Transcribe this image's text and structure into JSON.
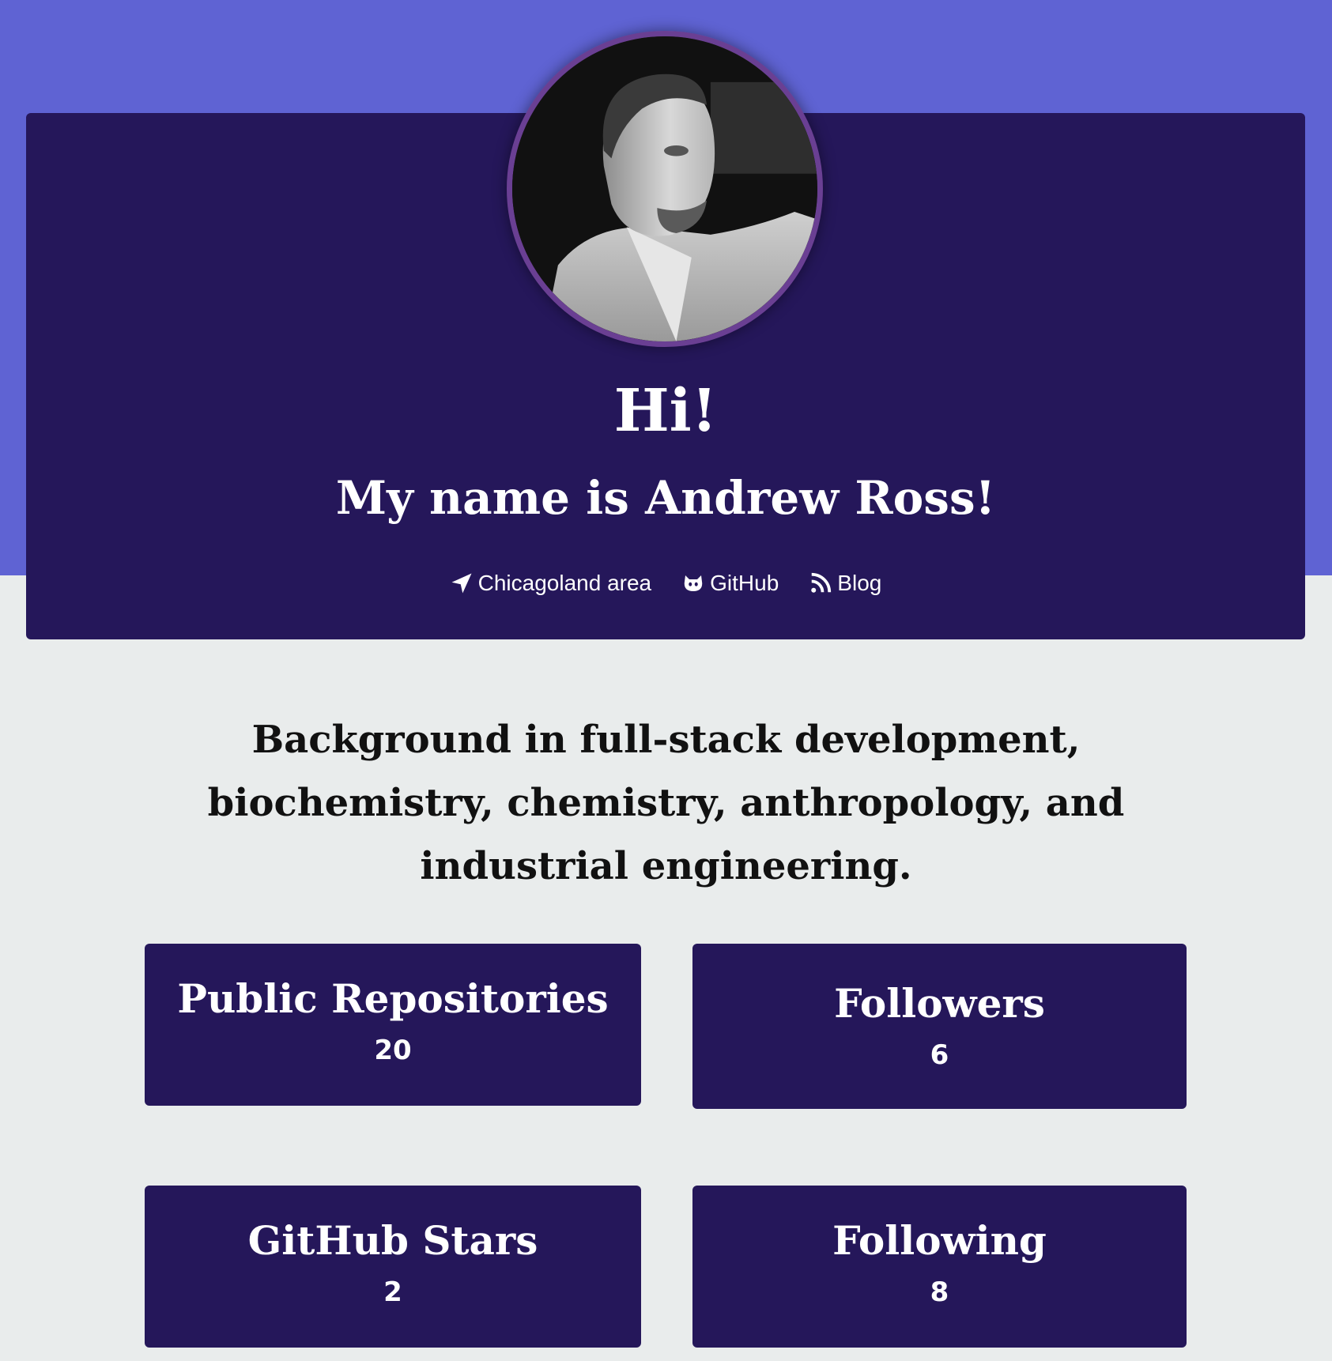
{
  "hero": {
    "greeting": "Hi!",
    "name_line": "My name is Andrew Ross!"
  },
  "links": [
    {
      "icon": "location-arrow-icon",
      "label": "Chicagoland area"
    },
    {
      "icon": "github-icon",
      "label": "GitHub"
    },
    {
      "icon": "rss-icon",
      "label": "Blog"
    }
  ],
  "bio": "Background in full-stack development, biochemistry, chemistry, anthropology, and industrial engineering.",
  "stats": {
    "public_repositories": {
      "label": "Public Repositories",
      "value": "20"
    },
    "followers": {
      "label": "Followers",
      "value": "6"
    },
    "github_stars": {
      "label": "GitHub Stars",
      "value": "2"
    },
    "following": {
      "label": "Following",
      "value": "8"
    }
  },
  "colors": {
    "band": "#5f63d3",
    "card": "#25175a",
    "page_background": "#e9ecec",
    "avatar_ring": "#6a3f93"
  }
}
